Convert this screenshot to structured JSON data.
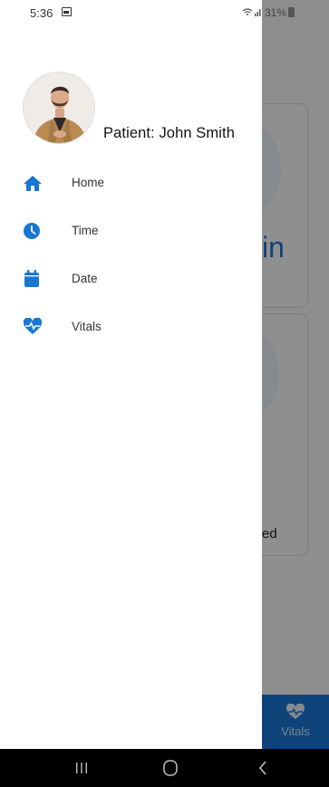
{
  "status_bar": {
    "time": "5:36",
    "right_text": "31%"
  },
  "drawer": {
    "patient_label": "Patient: John Smith",
    "menu_items": [
      {
        "label": "Home",
        "icon": "home-icon"
      },
      {
        "label": "Time",
        "icon": "clock-icon"
      },
      {
        "label": "Date",
        "icon": "calendar-icon"
      },
      {
        "label": "Vitals",
        "icon": "heart-pulse-icon"
      }
    ]
  },
  "background": {
    "partial_text_1": "in",
    "partial_text_2": "ed",
    "bottom_tab_label": "Vitals"
  },
  "colors": {
    "accent": "#1976d2",
    "drawer_bg": "#ffffff",
    "nav_bar": "#000000"
  }
}
